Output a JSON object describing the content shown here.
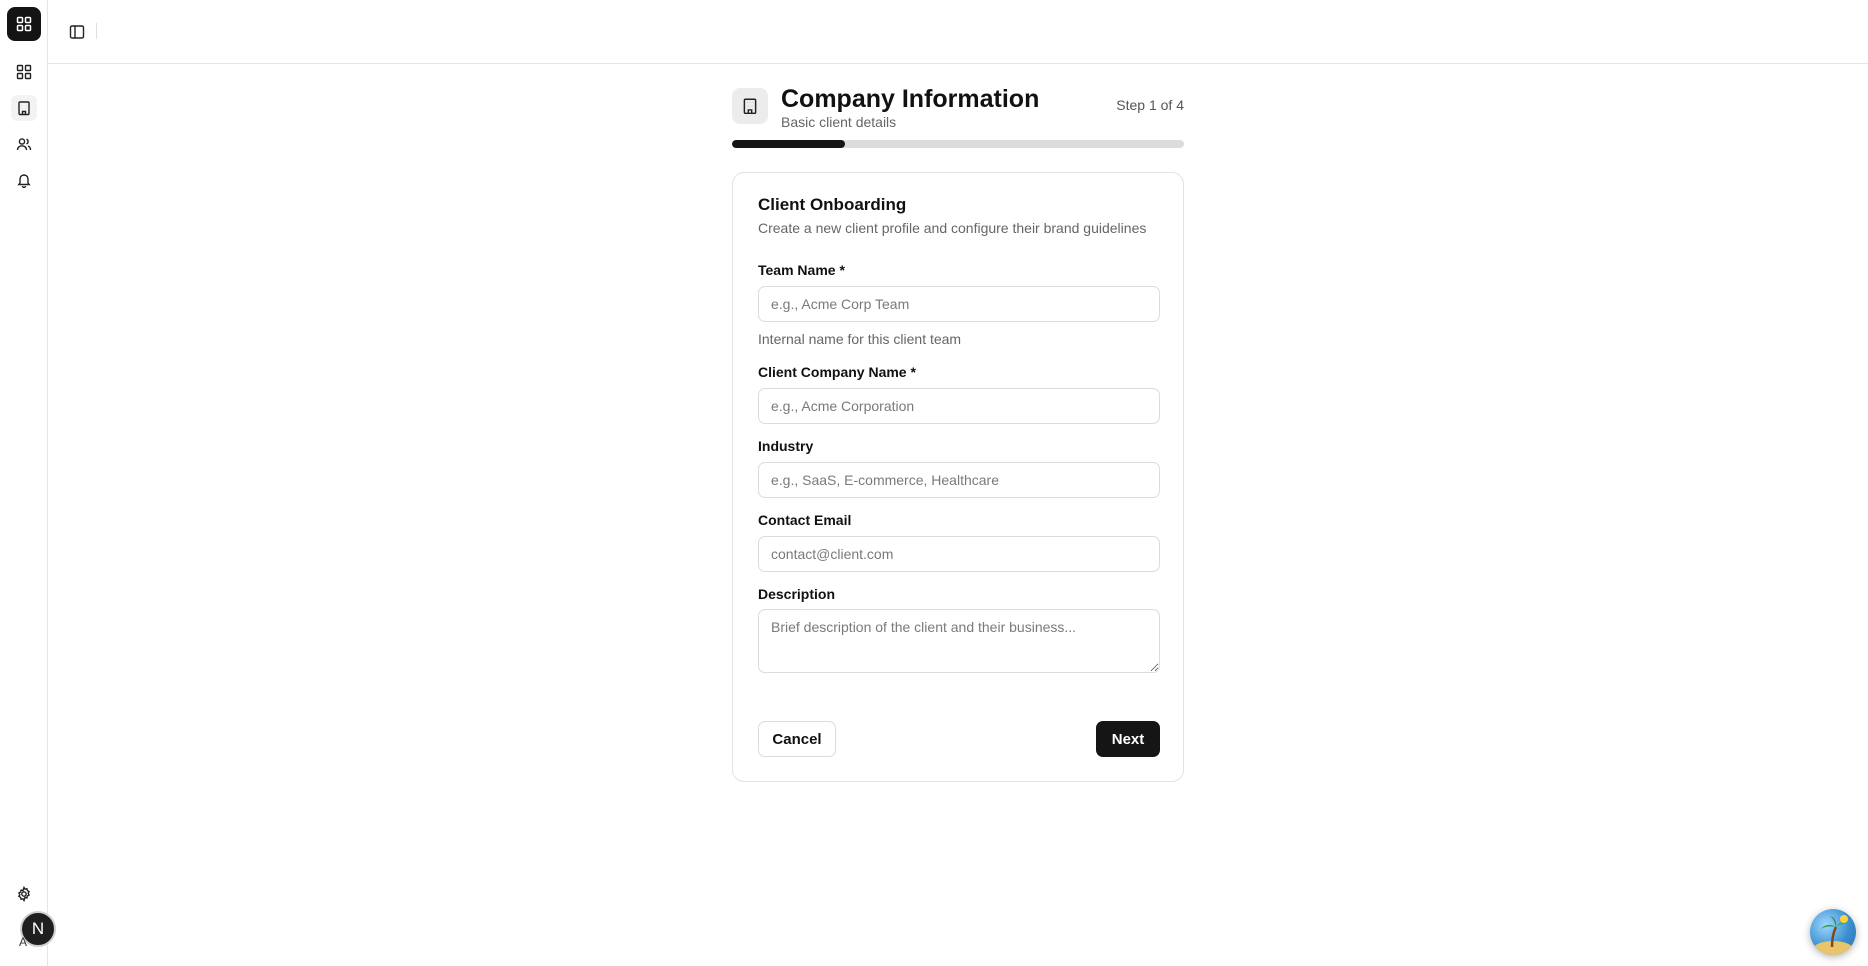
{
  "sidebar": {
    "logo": "grid-logo-icon",
    "items": [
      {
        "icon": "dashboard-icon",
        "active": false
      },
      {
        "icon": "building-icon",
        "active": true
      },
      {
        "icon": "users-icon",
        "active": false
      },
      {
        "icon": "bell-icon",
        "active": false
      }
    ],
    "settings_icon": "gear-icon",
    "avatar_letter": "N",
    "avatar_sub": "A"
  },
  "topbar": {
    "toggle_icon": "sidebar-toggle-icon"
  },
  "step": {
    "icon": "building-icon",
    "title": "Company Information",
    "subtitle": "Basic client details",
    "counter": "Step 1 of 4",
    "progress": 0.25
  },
  "form": {
    "title": "Client Onboarding",
    "description": "Create a new client profile and configure their brand guidelines",
    "team_name": {
      "label": "Team Name *",
      "placeholder": "e.g., Acme Corp Team",
      "value": "",
      "hint": "Internal name for this client team"
    },
    "company_name": {
      "label": "Client Company Name *",
      "placeholder": "e.g., Acme Corporation",
      "value": ""
    },
    "industry": {
      "label": "Industry",
      "placeholder": "e.g., SaaS, E-commerce, Healthcare",
      "value": ""
    },
    "contact_email": {
      "label": "Contact Email",
      "placeholder": "contact@client.com",
      "value": ""
    },
    "description_field": {
      "label": "Description",
      "placeholder": "Brief description of the client and their business...",
      "value": ""
    },
    "cancel_label": "Cancel",
    "next_label": "Next"
  },
  "colors": {
    "primary": "#151515",
    "border": "#e2e2e2",
    "muted_text": "#666666",
    "progress_track": "#dcdcdc"
  }
}
